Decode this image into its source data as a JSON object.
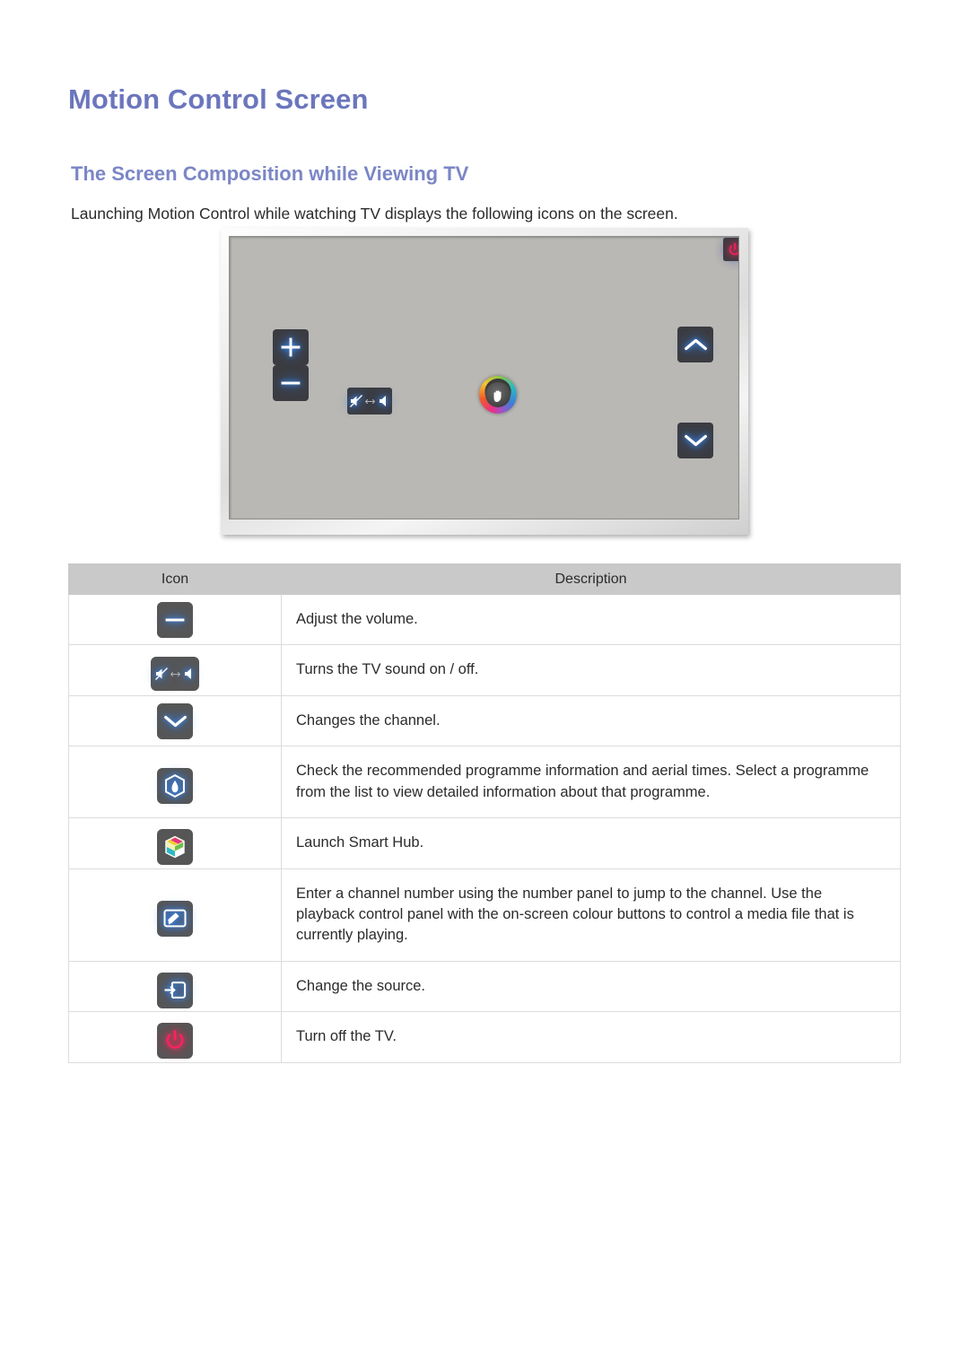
{
  "document": {
    "page_title": "Motion Control Screen",
    "section_title": "The Screen Composition while Viewing TV",
    "intro_text": "Launching Motion Control while watching TV displays the following icons on the screen."
  },
  "tv_illustration": {
    "name": "motion-control-osd-preview",
    "top_row_icons": [
      {
        "name": "smart-hub-icon",
        "label": "Smart Hub"
      },
      {
        "name": "guide-icon",
        "label": "Guide"
      },
      {
        "name": "media-panel-icon",
        "label": "Number / Playback Panel"
      },
      {
        "name": "source-icon",
        "label": "Source"
      },
      {
        "name": "power-icon",
        "label": "Power"
      }
    ],
    "left_icons": [
      {
        "name": "volume-up-icon",
        "label": "Volume Up"
      },
      {
        "name": "volume-down-icon",
        "label": "Volume Down"
      },
      {
        "name": "mute-icon",
        "label": "Mute On / Off"
      }
    ],
    "right_icons": [
      {
        "name": "channel-up-icon",
        "label": "Channel Up"
      },
      {
        "name": "channel-down-icon",
        "label": "Channel Down"
      }
    ],
    "cursor": {
      "name": "hand-cursor",
      "label": "Motion Control Hand Pointer"
    }
  },
  "table": {
    "headers": {
      "icon": "Icon",
      "description": "Description"
    },
    "rows": [
      {
        "icons": [
          "volume-up-icon",
          "volume-down-icon"
        ],
        "separator": "/",
        "description": "Adjust the volume."
      },
      {
        "icons": [
          "mute-icon"
        ],
        "separator": "",
        "description": "Turns the TV sound on / off."
      },
      {
        "icons": [
          "channel-up-icon",
          "channel-down-icon"
        ],
        "separator": "/",
        "description": "Changes the channel."
      },
      {
        "icons": [
          "guide-icon"
        ],
        "separator": "",
        "description": "Check the recommended programme information and aerial times. Select a programme from the list to view detailed information about that programme."
      },
      {
        "icons": [
          "smart-hub-icon"
        ],
        "separator": "",
        "description": "Launch Smart Hub."
      },
      {
        "icons": [
          "media-panel-icon"
        ],
        "separator": "",
        "description": "Enter a channel number using the number panel to jump to the channel. Use the playback control panel with the on-screen colour buttons to control a media file that is currently playing."
      },
      {
        "icons": [
          "source-icon"
        ],
        "separator": "",
        "description": "Change the source."
      },
      {
        "icons": [
          "power-icon"
        ],
        "separator": "",
        "description": "Turn off the TV."
      }
    ]
  },
  "colors": {
    "heading": "#6b76bd",
    "subheading": "#7b86c6",
    "body_text": "#2b2b2b",
    "table_header_bg": "#c9c9c9",
    "table_border": "#dcdcdc",
    "osd_button_bg": "#565656",
    "osd_glow_blue": "#3b8ff5",
    "osd_glow_red": "#ff2d62",
    "tv_screen_bg": "#b9b8b4"
  }
}
